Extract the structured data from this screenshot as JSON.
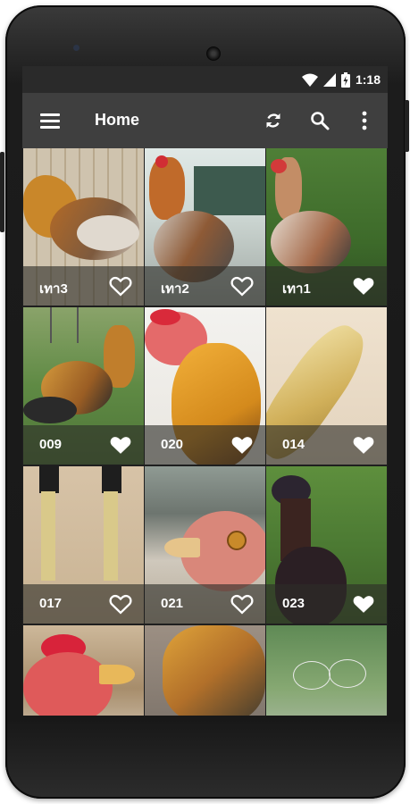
{
  "status_bar": {
    "time": "1:18",
    "icons": [
      "wifi-icon",
      "signal-icon",
      "battery-icon"
    ]
  },
  "app_bar": {
    "title": "Home",
    "actions": [
      "menu-icon",
      "refresh-icon",
      "search-icon",
      "more-vert-icon"
    ]
  },
  "gallery": {
    "items": [
      {
        "label": "เทา3",
        "favorite": "outline"
      },
      {
        "label": "เทา2",
        "favorite": "outline"
      },
      {
        "label": "เทา1",
        "favorite": "filled"
      },
      {
        "label": "009",
        "favorite": "filled"
      },
      {
        "label": "020",
        "favorite": "filled"
      },
      {
        "label": "014",
        "favorite": "filled"
      },
      {
        "label": "017",
        "favorite": "outline"
      },
      {
        "label": "021",
        "favorite": "outline"
      },
      {
        "label": "023",
        "favorite": "filled"
      },
      {
        "label": "",
        "favorite": ""
      },
      {
        "label": "",
        "favorite": ""
      },
      {
        "label": "",
        "favorite": ""
      }
    ]
  },
  "colors": {
    "app_bar": "#3f3f3f",
    "status_bar": "#2a2a2a",
    "tile_overlay": "#2d2d28",
    "icon": "#ffffff"
  }
}
